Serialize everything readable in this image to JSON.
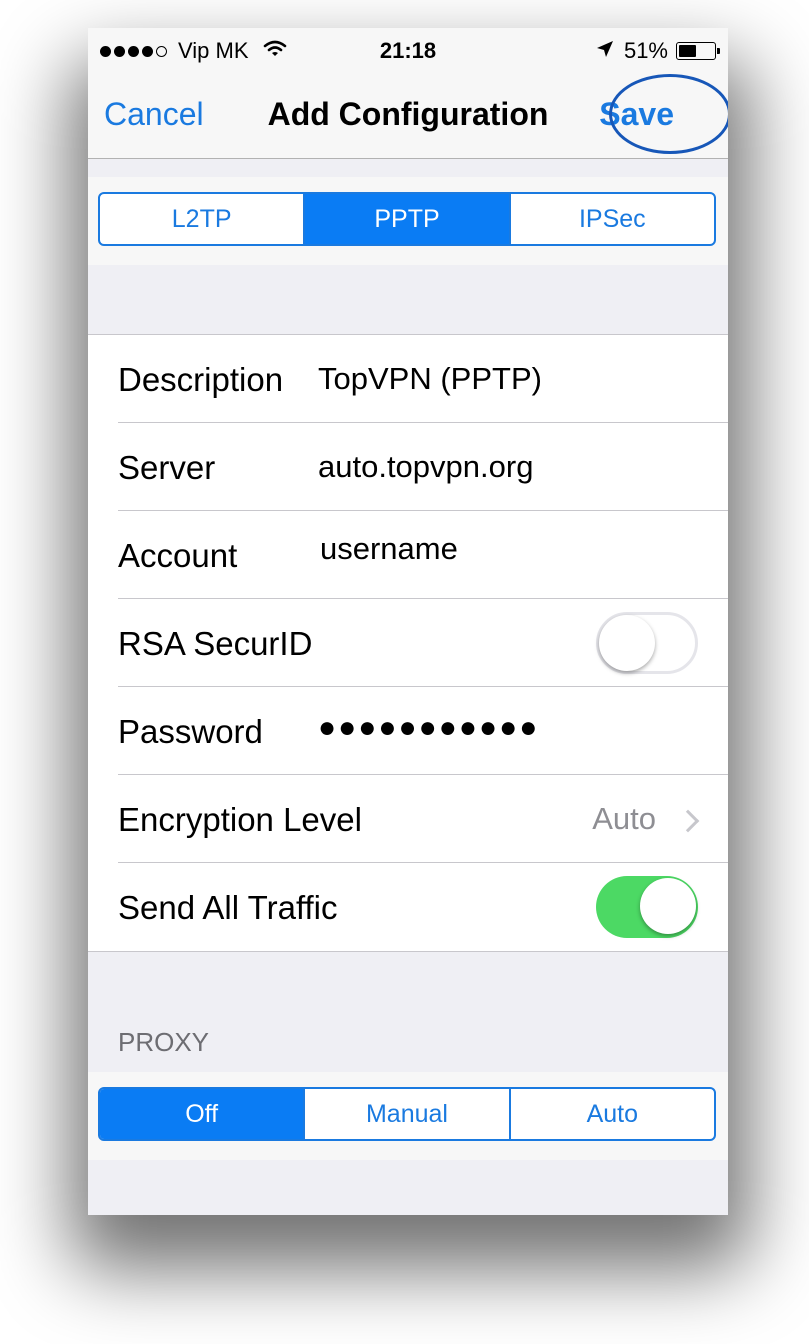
{
  "status_bar": {
    "carrier": "Vip MK",
    "time": "21:18",
    "battery": "51%",
    "battery_level": 0.51,
    "signal_bars": 4
  },
  "nav": {
    "cancel": "Cancel",
    "title": "Add Configuration",
    "save": "Save"
  },
  "vpn_type": {
    "options": [
      "L2TP",
      "PPTP",
      "IPSec"
    ],
    "selected": "PPTP"
  },
  "fields": {
    "description": {
      "label": "Description",
      "value": "TopVPN (PPTP)"
    },
    "server": {
      "label": "Server",
      "value": "auto.topvpn.org"
    },
    "account": {
      "label": "Account",
      "value": "username"
    },
    "rsa": {
      "label": "RSA SecurID",
      "on": false
    },
    "password": {
      "label": "Password",
      "value": "●●●●●●●●●●●"
    },
    "encryption": {
      "label": "Encryption Level",
      "value": "Auto"
    },
    "send_all": {
      "label": "Send All Traffic",
      "on": true
    }
  },
  "proxy": {
    "header": "PROXY",
    "options": [
      "Off",
      "Manual",
      "Auto"
    ],
    "selected": "Off"
  },
  "colors": {
    "accent": "#0a7cf4",
    "switch_on": "#4cd964",
    "annotation_circle": "#1757b8"
  },
  "icons": [
    "wifi-icon",
    "location-arrow-icon",
    "battery-icon",
    "chevron-right-icon"
  ]
}
